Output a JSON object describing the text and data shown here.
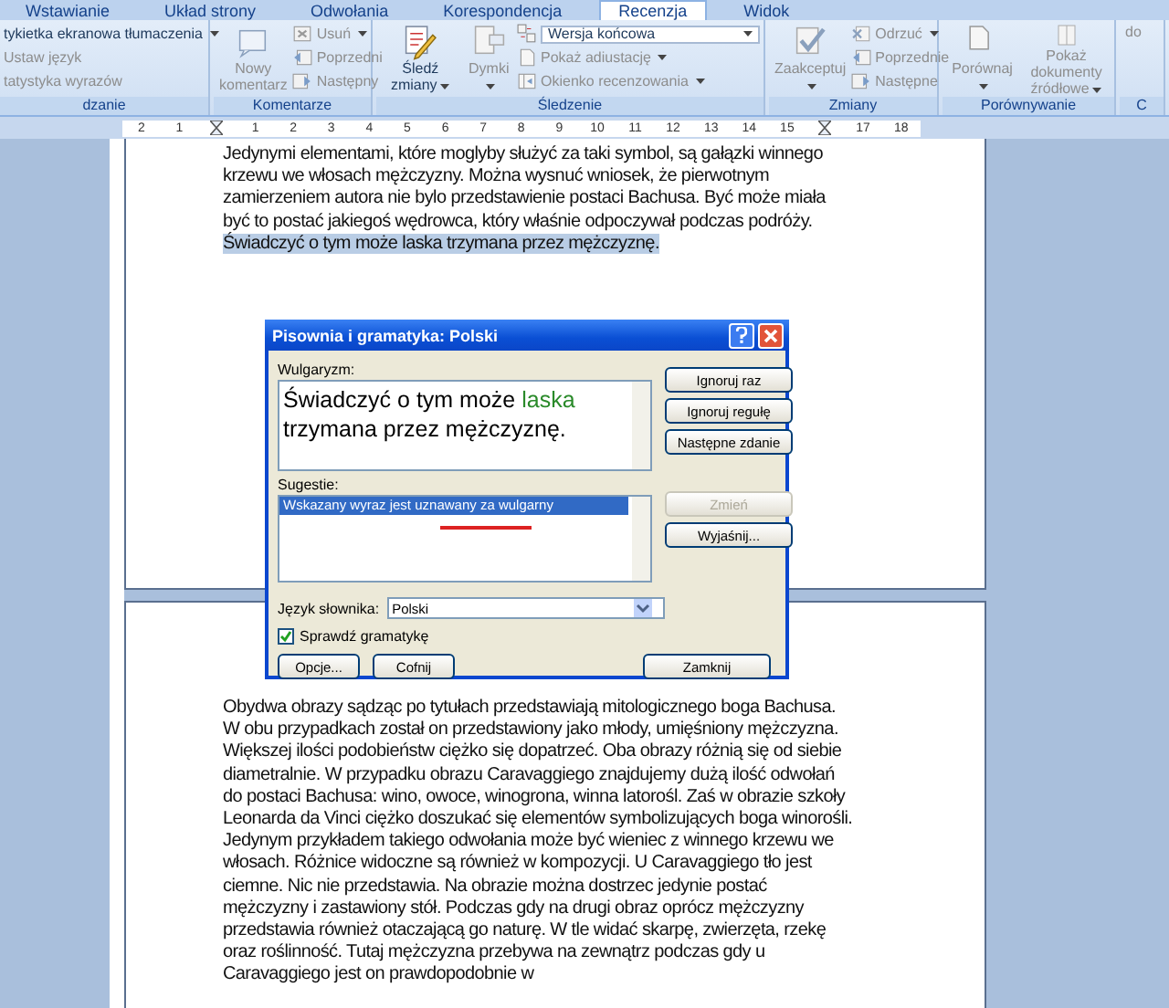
{
  "tabs": [
    {
      "label": "Wstawianie",
      "selected": false
    },
    {
      "label": "Układ strony",
      "selected": false
    },
    {
      "label": "Odwołania",
      "selected": false
    },
    {
      "label": "Korespondencja",
      "selected": false
    },
    {
      "label": "Recenzja",
      "selected": true
    },
    {
      "label": "Widok",
      "selected": false
    }
  ],
  "ribbon": {
    "groups": [
      {
        "label": "dzanie",
        "items": [
          {
            "kind": "small",
            "label": "tykietka ekranowa tłumaczenia",
            "disabled": false,
            "caret": true
          },
          {
            "kind": "small",
            "label": "Ustaw język",
            "disabled": true,
            "caret": false
          },
          {
            "kind": "small",
            "label": "tatystyka wyrazów",
            "disabled": true,
            "caret": false
          }
        ]
      },
      {
        "label": "Komentarze",
        "items": [
          {
            "kind": "large",
            "label": "Nowy komentarz",
            "disabled": true,
            "caret": false
          },
          {
            "kind": "small",
            "label": "Usuń",
            "disabled": true,
            "caret": true
          },
          {
            "kind": "small",
            "label": "Poprzedni",
            "disabled": true,
            "caret": false
          },
          {
            "kind": "small",
            "label": "Następny",
            "disabled": true,
            "caret": false
          }
        ]
      },
      {
        "label": "Śledzenie",
        "items": [
          {
            "kind": "large",
            "label": "Śledź zmiany",
            "disabled": false,
            "caret": true
          },
          {
            "kind": "large",
            "label": "Dymki",
            "disabled": true,
            "caret": true
          },
          {
            "kind": "dropdown",
            "label": "Wersja końcowa",
            "disabled": false,
            "caret": true
          },
          {
            "kind": "small",
            "label": "Pokaż adiustację",
            "disabled": true,
            "caret": true
          },
          {
            "kind": "small",
            "label": "Okienko recenzowania",
            "disabled": true,
            "caret": true
          }
        ]
      },
      {
        "label": "Zmiany",
        "items": [
          {
            "kind": "large",
            "label": "Zaakceptuj",
            "disabled": true,
            "caret": true
          },
          {
            "kind": "small",
            "label": "Odrzuć",
            "disabled": true,
            "caret": true
          },
          {
            "kind": "small",
            "label": "Poprzednie",
            "disabled": true,
            "caret": false
          },
          {
            "kind": "small",
            "label": "Następne",
            "disabled": true,
            "caret": false
          }
        ]
      },
      {
        "label": "Porównywanie",
        "items": [
          {
            "kind": "large",
            "label": "Porównaj",
            "disabled": true,
            "caret": true
          },
          {
            "kind": "large",
            "label": "Pokaż dokumenty źródłowe",
            "disabled": true,
            "caret": true
          }
        ]
      },
      {
        "label": "C",
        "items": [
          {
            "kind": "large",
            "label": "do",
            "disabled": true,
            "caret": false
          }
        ]
      }
    ]
  },
  "ruler": {
    "ticks": [
      {
        "kind": "number",
        "label": "2"
      },
      {
        "kind": "number",
        "label": "1"
      },
      {
        "kind": "marker"
      },
      {
        "kind": "number",
        "label": "1"
      },
      {
        "kind": "number",
        "label": "2"
      },
      {
        "kind": "number",
        "label": "3"
      },
      {
        "kind": "number",
        "label": "4"
      },
      {
        "kind": "number",
        "label": "5"
      },
      {
        "kind": "number",
        "label": "6"
      },
      {
        "kind": "number",
        "label": "7"
      },
      {
        "kind": "number",
        "label": "8"
      },
      {
        "kind": "number",
        "label": "9"
      },
      {
        "kind": "number",
        "label": "10"
      },
      {
        "kind": "number",
        "label": "11"
      },
      {
        "kind": "number",
        "label": "12"
      },
      {
        "kind": "number",
        "label": "13"
      },
      {
        "kind": "number",
        "label": "14"
      },
      {
        "kind": "number",
        "label": "15"
      },
      {
        "kind": "marker"
      },
      {
        "kind": "number",
        "label": "17"
      },
      {
        "kind": "number",
        "label": "18"
      }
    ]
  },
  "document": {
    "pages": [
      {
        "segments": [
          {
            "text": "Jedynymi elementami, które moglyby służyć za taki symbol, są gałązki winnego krzewu we włosach mężczyzny. Można wysnuć wniosek, że pierwotnym zamierzeniem autora nie bylo przedstawienie postaci Bachusa. Być może miała być to postać jakiegoś wędrowca, który właśnie odpoczywał podczas podróży. ",
            "selected": false
          },
          {
            "text": "Świadczyć o tym może laska trzymana przez mężczyznę.",
            "selected": true
          }
        ]
      },
      {
        "segments": [
          {
            "text": "Obydwa obrazy sądząc po tytułach przedstawiają mitologicznego boga Bachusa. W obu przypadkach został on przedstawiony jako młody, umięśniony mężczyzna. Większej ilości podobieństw ciężko się dopatrzeć. Oba obrazy różnią się od siebie diametralnie. W przypadku obrazu Caravaggiego znajdujemy dużą ilość odwołań do postaci Bachusa: wino, owoce, winogrona, winna latorośl. Zaś w obrazie szkoły Leonarda da Vinci ciężko doszukać się elementów symbolizujących boga winorośli. Jedynym przykładem takiego odwołania może być wieniec z winnego krzewu we włosach. Różnice widoczne są również w kompozycji. U Caravaggiego tło jest ciemne. Nic nie przedstawia. Na obrazie można dostrzec jedynie postać mężczyzny i zastawiony stół. Podczas gdy na drugi obraz oprócz mężczyzny przedstawia również otaczającą go naturę. W tle widać skarpę, zwierzęta, rzekę oraz roślinność. Tutaj mężczyzna przebywa na zewnątrz podczas gdy u Caravaggiego jest on prawdopodobnie w",
            "selected": false
          }
        ]
      }
    ]
  },
  "dialog": {
    "title": "Pisownia i gramatyka: Polski",
    "error_label": "Wulgaryzm:",
    "sentence": [
      {
        "text": "Świadczyć o tym może ",
        "flagged": false
      },
      {
        "text": "laska",
        "flagged": true
      },
      {
        "text": " trzymana przez mężczyznę.",
        "flagged": false
      }
    ],
    "suggestions_label": "Sugestie:",
    "suggestions": [
      {
        "label": "Wskazany wyraz jest uznawany za wulgarny",
        "selected": true
      }
    ],
    "side_buttons": [
      {
        "label": "Ignoruj raz",
        "disabled": false
      },
      {
        "label": "Ignoruj regułę",
        "disabled": false
      },
      {
        "label": "Następne zdanie",
        "disabled": false
      },
      {
        "label": "Zmień",
        "disabled": true
      },
      {
        "label": "Wyjaśnij...",
        "disabled": false
      }
    ],
    "language_label": "Język słownika:",
    "language": "Polski",
    "grammar_check": {
      "label": "Sprawdź gramatykę",
      "checked": true
    },
    "bottom_buttons": [
      {
        "label": "Opcje..."
      },
      {
        "label": "Cofnij"
      },
      {
        "label": "Zamknij"
      }
    ]
  }
}
